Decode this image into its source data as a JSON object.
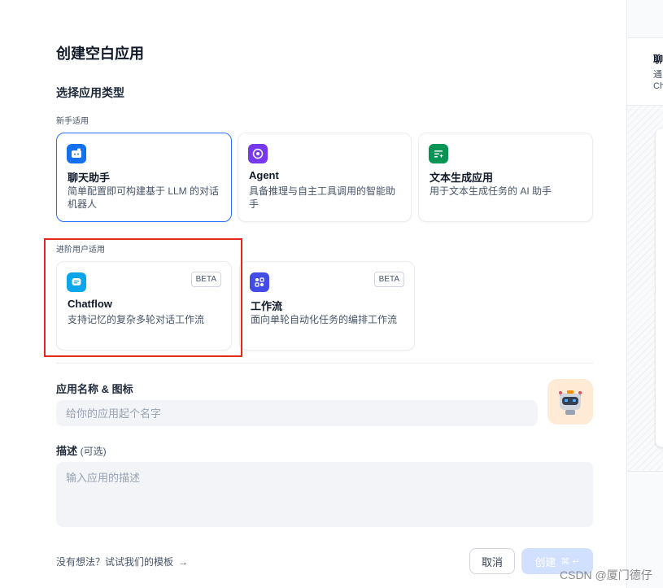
{
  "dialog": {
    "title": "创建空白应用",
    "section_title": "选择应用类型",
    "beginner_label": "新手适用",
    "advanced_label": "进阶用户适用"
  },
  "app_types": {
    "chat": {
      "title": "聊天助手",
      "desc": "简单配置即可构建基于 LLM 的对话机器人",
      "icon": "chat-bot-icon",
      "color": "#1570ef"
    },
    "agent": {
      "title": "Agent",
      "desc": "具备推理与自主工具调用的智能助手",
      "icon": "agent-icon",
      "color": "#7839ee"
    },
    "text": {
      "title": "文本生成应用",
      "desc": "用于文本生成任务的 AI 助手",
      "icon": "text-generation-icon",
      "color": "#079455"
    },
    "chatflow": {
      "title": "Chatflow",
      "desc": "支持记忆的复杂多轮对话工作流",
      "badge": "BETA",
      "icon": "chatflow-icon",
      "color": "#0ba5ec"
    },
    "workflow": {
      "title": "工作流",
      "desc": "面向单轮自动化任务的编排工作流",
      "badge": "BETA",
      "icon": "workflow-icon",
      "color": "#444ce7"
    }
  },
  "form": {
    "name_label": "应用名称 & 图标",
    "name_placeholder": "给你的应用起个名字",
    "desc_label": "描述",
    "desc_optional": "(可选)",
    "desc_placeholder": "输入应用的描述",
    "avatar_icon": "robot-avatar-icon"
  },
  "footer": {
    "template_link": "没有想法？试试我们的模板",
    "cancel": "取消",
    "create": "创建",
    "create_shortcut": "⌘ ↵"
  },
  "preview": {
    "title": "聊",
    "line1": "通",
    "line2": "Ch"
  },
  "watermark": "CSDN @厦门德仔"
}
